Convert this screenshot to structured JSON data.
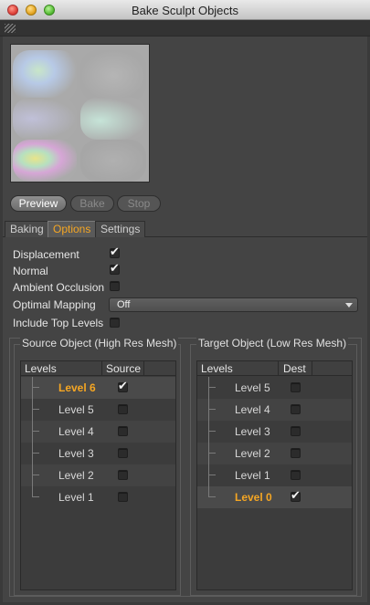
{
  "window": {
    "title": "Bake Sculpt Objects"
  },
  "buttons": {
    "preview": "Preview",
    "bake": "Bake",
    "stop": "Stop"
  },
  "tabs": [
    {
      "label": "Baking",
      "active": false
    },
    {
      "label": "Options",
      "active": true
    },
    {
      "label": "Settings",
      "active": false
    }
  ],
  "options": {
    "displacement": {
      "label": "Displacement",
      "checked": true
    },
    "normal": {
      "label": "Normal",
      "checked": true
    },
    "ambient_occlusion": {
      "label": "Ambient Occlusion",
      "checked": false
    },
    "optimal_mapping": {
      "label": "Optimal Mapping",
      "value": "Off"
    },
    "include_top_levels": {
      "label": "Include Top Levels",
      "checked": false
    }
  },
  "source": {
    "title": "Source Object (High Res Mesh)",
    "col_levels": "Levels",
    "col_flag": "Source",
    "rows": [
      {
        "label": "Level 6",
        "checked": true,
        "active": true
      },
      {
        "label": "Level 5",
        "checked": false,
        "active": false
      },
      {
        "label": "Level 4",
        "checked": false,
        "active": false
      },
      {
        "label": "Level 3",
        "checked": false,
        "active": false
      },
      {
        "label": "Level 2",
        "checked": false,
        "active": false
      },
      {
        "label": "Level 1",
        "checked": false,
        "active": false
      }
    ]
  },
  "target": {
    "title": "Target Object (Low Res Mesh)",
    "col_levels": "Levels",
    "col_flag": "Dest",
    "rows": [
      {
        "label": "Level 5",
        "checked": false,
        "active": false
      },
      {
        "label": "Level 4",
        "checked": false,
        "active": false
      },
      {
        "label": "Level 3",
        "checked": false,
        "active": false
      },
      {
        "label": "Level 2",
        "checked": false,
        "active": false
      },
      {
        "label": "Level 1",
        "checked": false,
        "active": false
      },
      {
        "label": "Level 0",
        "checked": true,
        "active": true
      }
    ]
  },
  "colors": {
    "accent": "#f5a623",
    "panel": "#444444"
  }
}
